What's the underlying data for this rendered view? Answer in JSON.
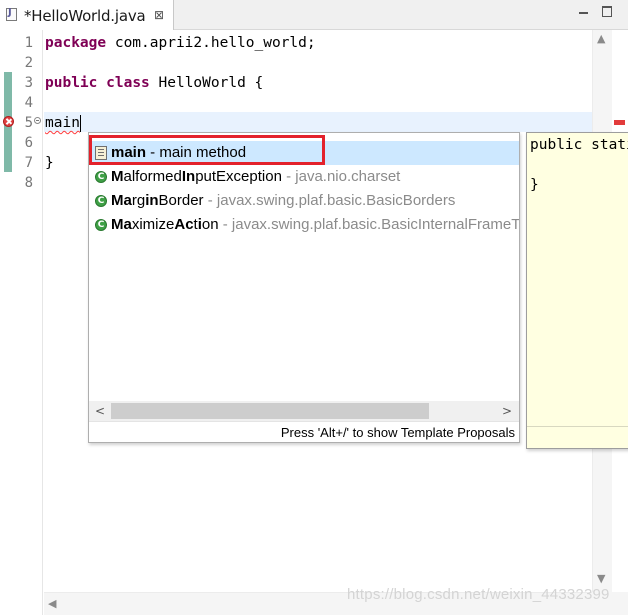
{
  "tab": {
    "title": "*HelloWorld.java",
    "close_glyph": "⊠"
  },
  "editor": {
    "line_numbers": [
      "1",
      "2",
      "3",
      "4",
      "5",
      "6",
      "7",
      "8"
    ],
    "lines": {
      "l1_kw": "package",
      "l1_rest": " com.aprii2.hello_world;",
      "l3_kw1": "public",
      "l3_kw2": "class",
      "l3_rest": " HelloWorld {",
      "l5_text": "main",
      "l7_text": "}"
    },
    "colors": {
      "keyword": "#7f0055",
      "change_bar": "#7fb9a8",
      "error": "#e04040",
      "current_line": "#e8f2fe"
    }
  },
  "content_assist": {
    "proposals": [
      {
        "bold": "main",
        "rest": "",
        "detail": " - main method",
        "icon": "template-icon"
      },
      {
        "bold": "M",
        "rest": "alformed",
        "bold2": "I",
        "rest2": "nputException",
        "detail": " - java.nio.charset",
        "icon": "class-icon"
      },
      {
        "bold": "Ma",
        "rest": "rgi",
        "bold2": "n",
        "rest2": "Border",
        "detail": " - javax.swing.plaf.basic.BasicBorders",
        "icon": "class-icon"
      },
      {
        "bold": "Ma",
        "rest": "x",
        "bold2": "i",
        "rest2": "mizeAction",
        "bold3": "n",
        "rest3": "",
        "detail": " - javax.swing.plaf.basic.BasicInternalFrameTitlePane",
        "icon": "class-icon"
      }
    ],
    "row2": {
      "b1": "M",
      "t1": "alformed",
      "b2": "In",
      "t2": "putException",
      "detail": " - java.nio.charset"
    },
    "row3": {
      "b1": "Ma",
      "t1": "rg",
      "b2": "in",
      "t2": "Border",
      "detail": " - javax.swing.plaf.basic.BasicBorders"
    },
    "row4": {
      "b1": "Ma",
      "t1": "ximize",
      "b2": "Ac",
      "t2": "t",
      "b3": "i",
      "t3": "on",
      "detail": " - javax.swing.plaf.basic.BasicInternalFrameTitlePane"
    },
    "row1": {
      "b1": "main",
      "detail": " - main method"
    },
    "status": "Press 'Alt+/' to show Template Proposals",
    "highlight_color": "#e3212b",
    "selected_color": "#cde8ff",
    "class_icon_letter": "C"
  },
  "doc_popup": {
    "line1": "public static",
    "line2": "}"
  },
  "watermark": "https://blog.csdn.net/weixin_44332399"
}
